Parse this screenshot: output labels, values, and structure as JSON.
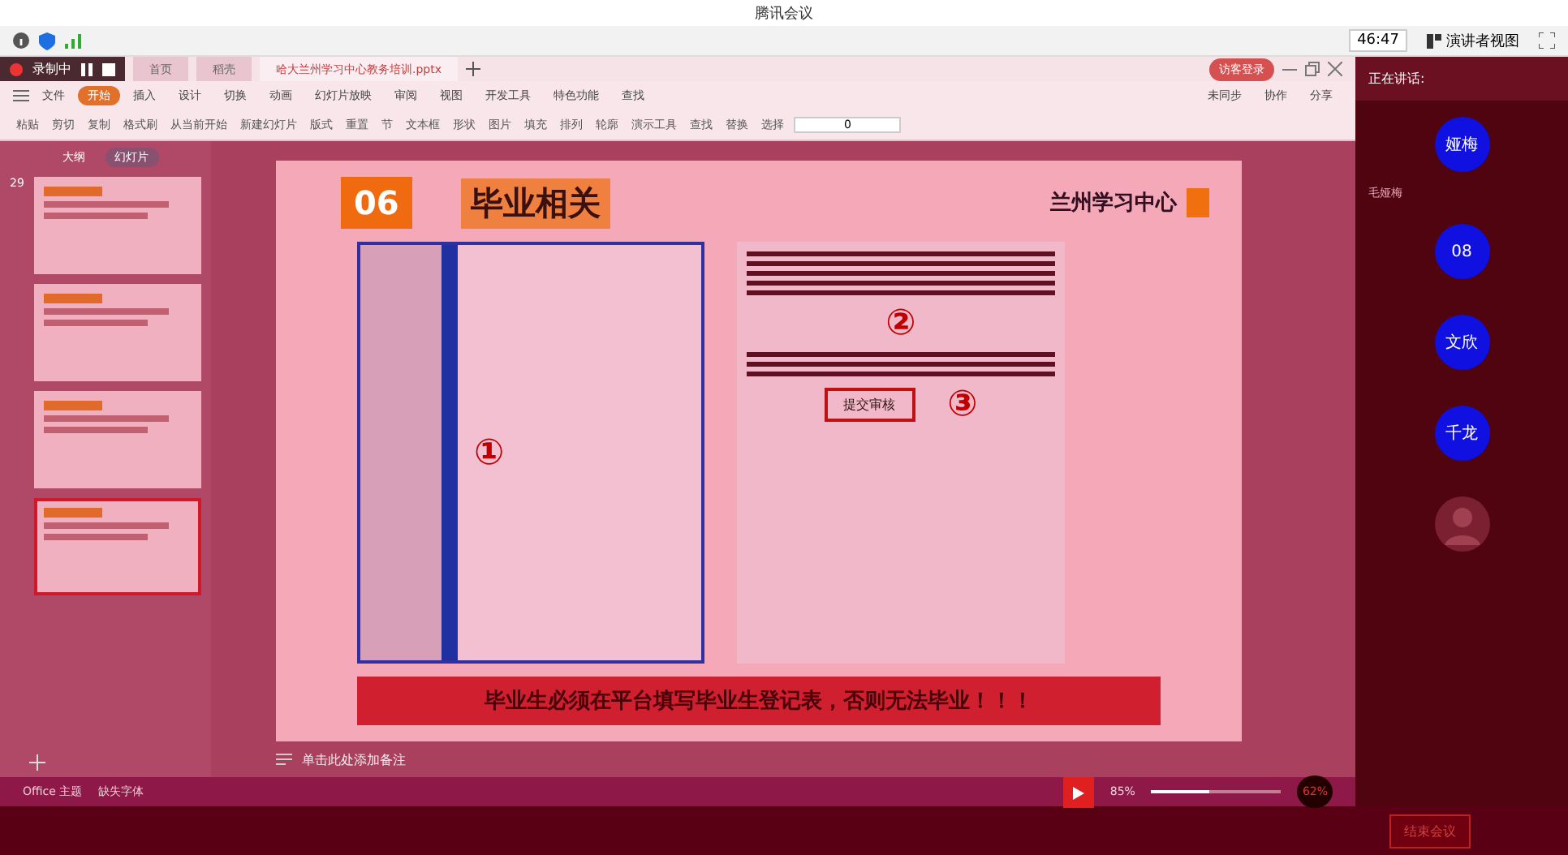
{
  "title_bar": {
    "title": "腾讯会议"
  },
  "meeting_bar": {
    "timer": "46:47",
    "view_button": "演讲者视图"
  },
  "recording": {
    "label": "录制中"
  },
  "doc_tabs": [
    {
      "label": "首页",
      "selected": false
    },
    {
      "label": "稻壳",
      "selected": false
    },
    {
      "label": "哈大兰州学习中心教务培训.pptx",
      "selected": true
    }
  ],
  "account": "访客登录",
  "menu": [
    {
      "label": "文件",
      "selected": false
    },
    {
      "label": "开始",
      "selected": true
    },
    {
      "label": "插入",
      "selected": false
    },
    {
      "label": "设计",
      "selected": false
    },
    {
      "label": "切换",
      "selected": false
    },
    {
      "label": "动画",
      "selected": false
    },
    {
      "label": "幻灯片放映",
      "selected": false
    },
    {
      "label": "审阅",
      "selected": false
    },
    {
      "label": "视图",
      "selected": false
    },
    {
      "label": "开发工具",
      "selected": false
    },
    {
      "label": "特色功能",
      "selected": false
    }
  ],
  "menu_search": "查找",
  "sync_actions": [
    "未同步",
    "协作",
    "分享"
  ],
  "ribbon": [
    "粘贴",
    "剪切",
    "复制",
    "格式刷",
    "从当前开始",
    "新建幻灯片",
    "版式",
    "重置",
    "节",
    "文本框",
    "形状",
    "图片",
    "填充",
    "排列",
    "轮廓",
    "演示工具",
    "查找",
    "替换",
    "选择"
  ],
  "font_size": "0",
  "slide_panel": {
    "tabs": [
      {
        "label": "大纲",
        "selected": false
      },
      {
        "label": "幻灯片",
        "selected": true
      }
    ],
    "thumbnails": [
      {
        "number": "29",
        "selected": false
      },
      {
        "selected": false
      },
      {
        "selected": false
      },
      {
        "selected": true
      }
    ]
  },
  "slide": {
    "number": "06",
    "title": "毕业相关",
    "center": "兰州学习中心",
    "steps": [
      "①",
      "②",
      "③"
    ],
    "submit_button": "提交审核",
    "banner": "毕业生必须在平台填写毕业生登记表，否则无法毕业！！！"
  },
  "notes_placeholder": "单击此处添加备注",
  "status_bar": {
    "theme": "Office 主题",
    "fonts": "缺失字体",
    "zoom": "85%",
    "level": 0.45,
    "cpu": "62%"
  },
  "speaking": {
    "label": "正在讲话:",
    "name": "毛娅梅"
  },
  "participants": [
    {
      "avatar": "娅梅"
    },
    {
      "avatar": "08"
    },
    {
      "avatar": "文欣"
    },
    {
      "avatar": "千龙"
    }
  ],
  "end_button": "结束会议"
}
